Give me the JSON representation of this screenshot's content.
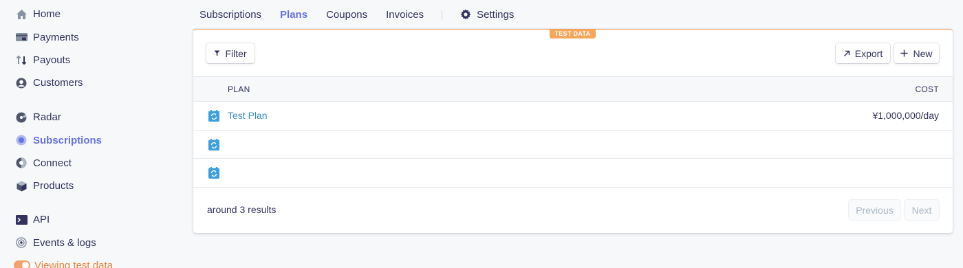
{
  "sidebar": {
    "items": [
      {
        "label": "Home",
        "icon": "home-icon"
      },
      {
        "label": "Payments",
        "icon": "payments-icon"
      },
      {
        "label": "Payouts",
        "icon": "payouts-icon"
      },
      {
        "label": "Customers",
        "icon": "customers-icon"
      },
      {
        "label": "Radar",
        "icon": "radar-icon"
      },
      {
        "label": "Subscriptions",
        "icon": "subscriptions-icon"
      },
      {
        "label": "Connect",
        "icon": "connect-icon"
      },
      {
        "label": "Products",
        "icon": "products-icon"
      },
      {
        "label": "API",
        "icon": "terminal-icon"
      },
      {
        "label": "Events & logs",
        "icon": "events-icon"
      },
      {
        "label": "Viewing test data",
        "icon": "toggle-icon"
      }
    ],
    "active_item": "Subscriptions"
  },
  "tabs": {
    "items": [
      "Subscriptions",
      "Plans",
      "Coupons",
      "Invoices"
    ],
    "active": "Plans",
    "settings_label": "Settings"
  },
  "card": {
    "badge": "TEST DATA",
    "filter_label": "Filter",
    "export_label": "Export",
    "new_label": "New",
    "columns": [
      "PLAN",
      "COST"
    ],
    "rows": [
      {
        "plan": "Test Plan",
        "cost": "¥1,000,000/day"
      },
      {
        "plan": "",
        "cost": ""
      },
      {
        "plan": "",
        "cost": ""
      }
    ],
    "results_text": "around 3 results",
    "previous_label": "Previous",
    "next_label": "Next"
  },
  "colors": {
    "accent": "#6772e5",
    "link": "#3a8fc7",
    "test_orange": "#f5a65b",
    "text": "#32325d"
  }
}
